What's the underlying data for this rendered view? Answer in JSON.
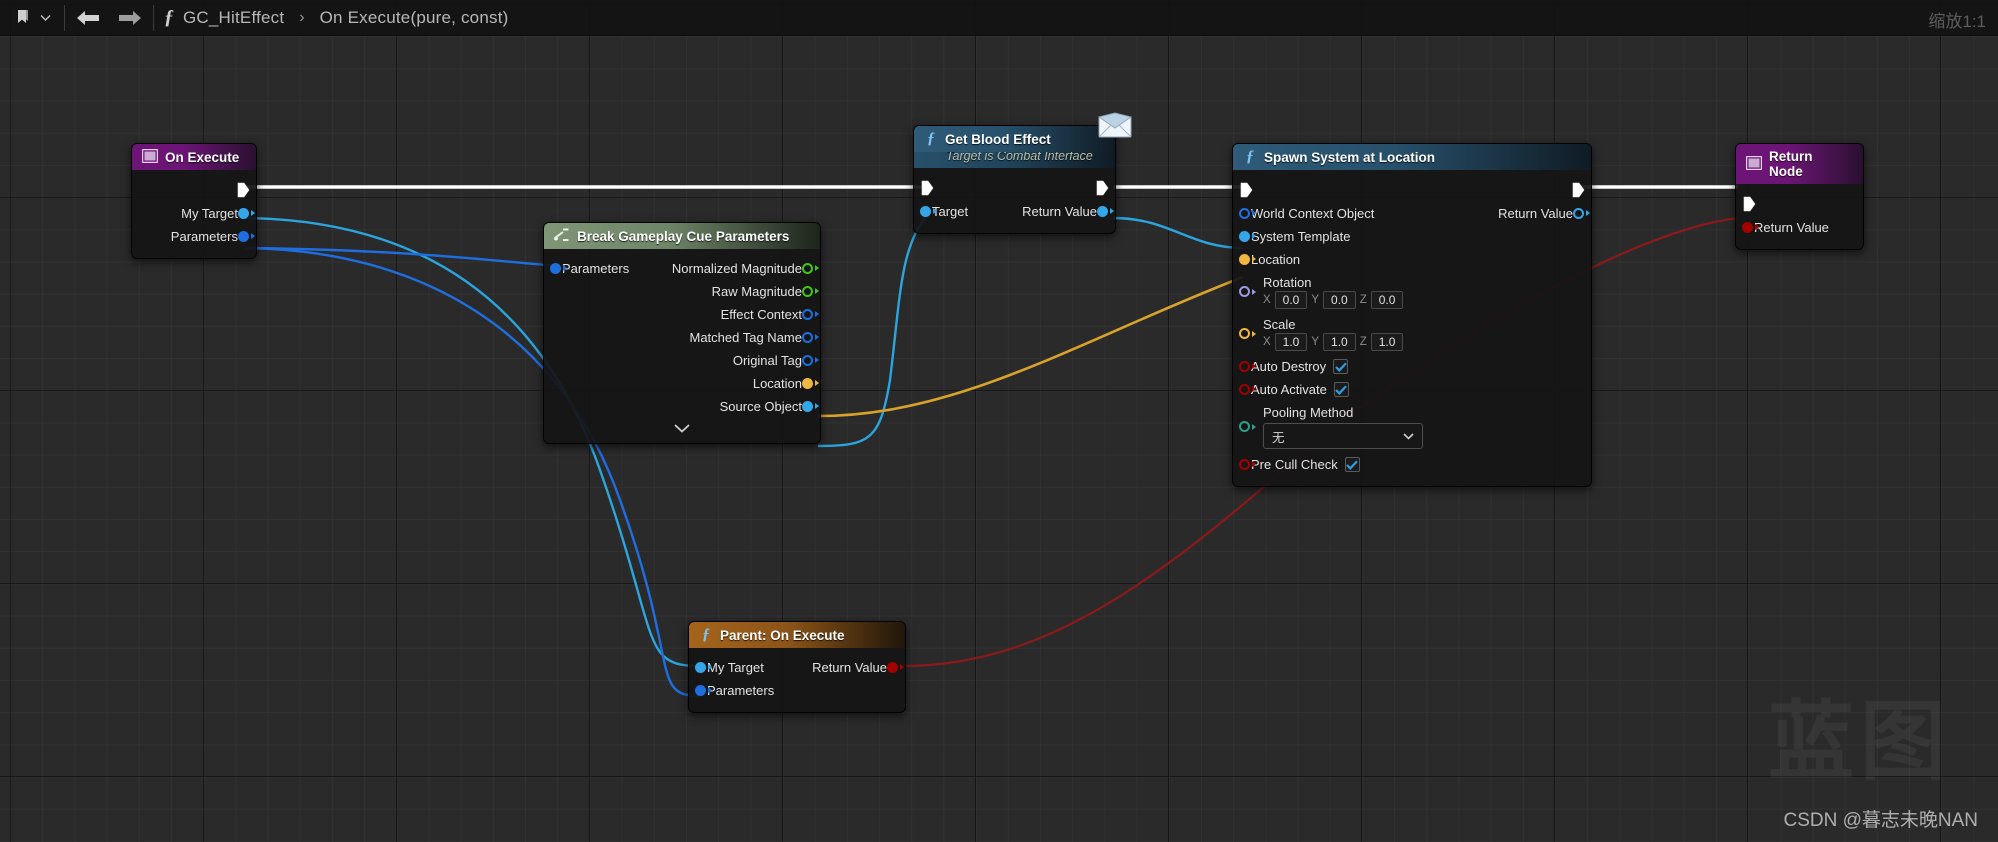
{
  "toolbar": {
    "bookmark_icon": "bookmark-icon",
    "dropdown_icon": "chevron-down-icon",
    "back_icon": "arrow-left-icon",
    "forward_icon": "arrow-right-icon",
    "function_icon": "function-fx-icon",
    "breadcrumb_root": "GC_HitEffect",
    "breadcrumb_separator": "›",
    "breadcrumb_current": "On Execute(pure, const)",
    "zoom_label": "缩放1:1"
  },
  "watermark": {
    "big": "蓝图",
    "small": "CSDN @暮志未晚NAN"
  },
  "colors": {
    "exec_white": "#ffffff",
    "object_blue": "#35a6e8",
    "struct_blue": "#1f6ee0",
    "vector_gold": "#efb641",
    "bool_red": "#a40000",
    "float_green": "#3ec71a",
    "rotator_purple": "#9b9be2",
    "enum_teal": "#2aa08b",
    "wire_cyan": "#2ba5dd",
    "wire_blue": "#1f6ee0",
    "wire_gold": "#d9a22b",
    "wire_red": "#8c1a1a"
  },
  "nodes": [
    {
      "id": "on-execute",
      "name": "On Execute",
      "style": "purple",
      "icon": "event-node-icon",
      "subtitle": "",
      "has_exec_in": false,
      "has_exec_out": true,
      "inputs": [],
      "outputs": [
        {
          "label": "My Target",
          "pin": "dot",
          "color": "#35a6e8"
        },
        {
          "label": "Parameters",
          "pin": "dot",
          "color": "#1f6ee0"
        }
      ]
    },
    {
      "id": "break-gameplay-cue-parameters",
      "name": "Break Gameplay Cue Parameters",
      "style": "green",
      "icon": "break-struct-icon",
      "subtitle": "",
      "has_exec_in": false,
      "has_exec_out": false,
      "expander": "chevron-down-icon",
      "inputs": [
        {
          "label": "Parameters",
          "pin": "dot",
          "color": "#1f6ee0"
        }
      ],
      "outputs": [
        {
          "label": "Normalized Magnitude",
          "pin": "ring",
          "color": "#3ec71a"
        },
        {
          "label": "Raw Magnitude",
          "pin": "ring",
          "color": "#3ec71a"
        },
        {
          "label": "Effect Context",
          "pin": "ring",
          "color": "#1f6ee0"
        },
        {
          "label": "Matched Tag Name",
          "pin": "ring",
          "color": "#1f6ee0"
        },
        {
          "label": "Original Tag",
          "pin": "ring",
          "color": "#1f6ee0"
        },
        {
          "label": "Location",
          "pin": "dot",
          "color": "#efb641"
        },
        {
          "label": "Source Object",
          "pin": "dot",
          "color": "#35a6e8"
        }
      ]
    },
    {
      "id": "get-blood-effect",
      "name": "Get Blood Effect",
      "style": "blue",
      "icon": "function-fx-icon",
      "badge_icon": "interface-message-icon",
      "subtitle": "Target is Combat Interface",
      "has_exec_in": true,
      "has_exec_out": true,
      "inputs": [
        {
          "label": "Target",
          "pin": "dot",
          "color": "#35a6e8"
        }
      ],
      "outputs": [
        {
          "label": "Return Value",
          "pin": "dot",
          "color": "#35a6e8"
        }
      ]
    },
    {
      "id": "spawn-system-at-location",
      "name": "Spawn System at Location",
      "style": "blue",
      "icon": "function-fx-icon",
      "subtitle": "",
      "has_exec_in": true,
      "has_exec_out": true,
      "inputs": [
        {
          "label": "World Context Object",
          "pin": "ring",
          "color": "#1f6ee0"
        },
        {
          "label": "System Template",
          "pin": "dot",
          "color": "#35a6e8"
        },
        {
          "label": "Location",
          "pin": "dot",
          "color": "#efb641"
        },
        {
          "label": "Rotation",
          "pin": "ring",
          "color": "#9b9be2",
          "widget": "vector",
          "axes": [
            "X",
            "Y",
            "Z"
          ],
          "values": [
            "0.0",
            "0.0",
            "0.0"
          ]
        },
        {
          "label": "Scale",
          "pin": "ring",
          "color": "#efb641",
          "widget": "vector",
          "axes": [
            "X",
            "Y",
            "Z"
          ],
          "values": [
            "1.0",
            "1.0",
            "1.0"
          ]
        },
        {
          "label": "Auto Destroy",
          "pin": "ring",
          "color": "#a40000",
          "widget": "checkbox",
          "checked": true
        },
        {
          "label": "Auto Activate",
          "pin": "ring",
          "color": "#a40000",
          "widget": "checkbox",
          "checked": true
        },
        {
          "label": "Pooling Method",
          "pin": "ring",
          "color": "#2aa08b",
          "widget": "combo",
          "value": "无",
          "chevron": "chevron-down-icon"
        },
        {
          "label": "Pre Cull Check",
          "pin": "ring",
          "color": "#a40000",
          "widget": "checkbox",
          "checked": true
        }
      ],
      "outputs": [
        {
          "label": "Return Value",
          "pin": "ring",
          "color": "#35a6e8"
        }
      ]
    },
    {
      "id": "parent-on-execute",
      "name": "Parent: On Execute",
      "style": "orange",
      "icon": "function-fx-icon",
      "subtitle": "",
      "has_exec_in": false,
      "has_exec_out": false,
      "inputs": [
        {
          "label": "My Target",
          "pin": "dot",
          "color": "#35a6e8"
        },
        {
          "label": "Parameters",
          "pin": "dot",
          "color": "#1f6ee0"
        }
      ],
      "outputs": [
        {
          "label": "Return Value",
          "pin": "dot",
          "color": "#a40000"
        }
      ]
    },
    {
      "id": "return-node",
      "name": "Return Node",
      "style": "purple",
      "icon": "event-node-icon",
      "subtitle": "",
      "has_exec_in": true,
      "has_exec_out": false,
      "inputs": [
        {
          "label": "Return Value",
          "pin": "dot",
          "color": "#a40000"
        }
      ],
      "outputs": []
    }
  ]
}
